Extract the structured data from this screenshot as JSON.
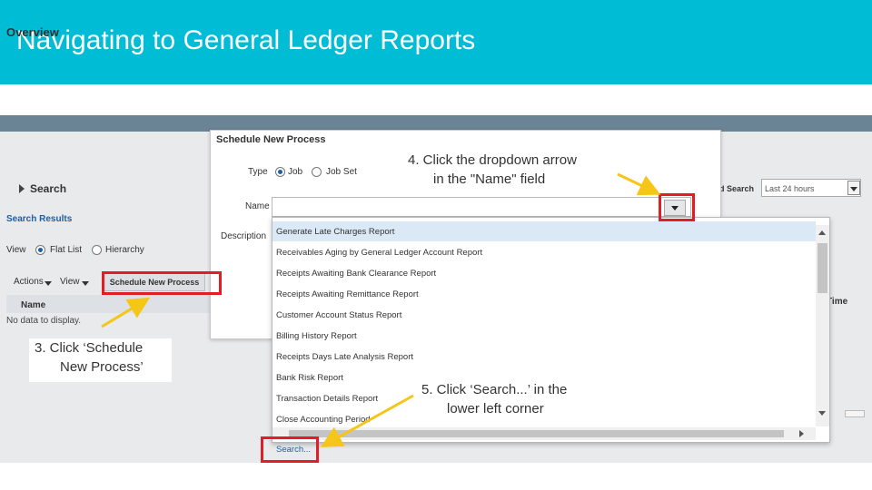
{
  "slide": {
    "title": "Navigating to General Ledger Reports"
  },
  "background_app": {
    "overview_title": "Overview",
    "search_section": "Search",
    "search_results": "Search Results",
    "view_label": "View",
    "view_options": [
      "Flat List",
      "Hierarchy"
    ],
    "actions_menu": "Actions",
    "view_menu": "View",
    "schedule_button": "Schedule New Process",
    "name_column": "Name",
    "no_data": "No data to display.",
    "advanced_search_label": "d Search",
    "time_filter_value": "Last 24 hours",
    "time_column": "Time"
  },
  "dialog": {
    "title": "Schedule New Process",
    "type_label": "Type",
    "type_options": [
      "Job",
      "Job Set"
    ],
    "name_label": "Name",
    "name_value": "",
    "description_label": "Description"
  },
  "dropdown": {
    "options": [
      "Generate Late Charges Report",
      "Receivables Aging by General Ledger Account Report",
      "Receipts Awaiting Bank Clearance Report",
      "Receipts Awaiting Remittance Report",
      "Customer Account Status Report",
      "Billing History Report",
      "Receipts Days Late Analysis Report",
      "Bank Risk Report",
      "Transaction Details Report",
      "Close Accounting Period"
    ],
    "search_link": "Search..."
  },
  "notes": {
    "step3": [
      "3.   Click ‘Schedule",
      "New Process’"
    ],
    "step4": [
      "4.   Click the dropdown arrow",
      "in the \"Name\" field"
    ],
    "step5": [
      "5.   Click ‘Search...’ in the",
      "lower left corner"
    ]
  },
  "colors": {
    "header": "#00bcd4",
    "callout_red": "#e21e24",
    "arrow_yellow": "#f5c518",
    "link_blue": "#1a5fa8"
  }
}
